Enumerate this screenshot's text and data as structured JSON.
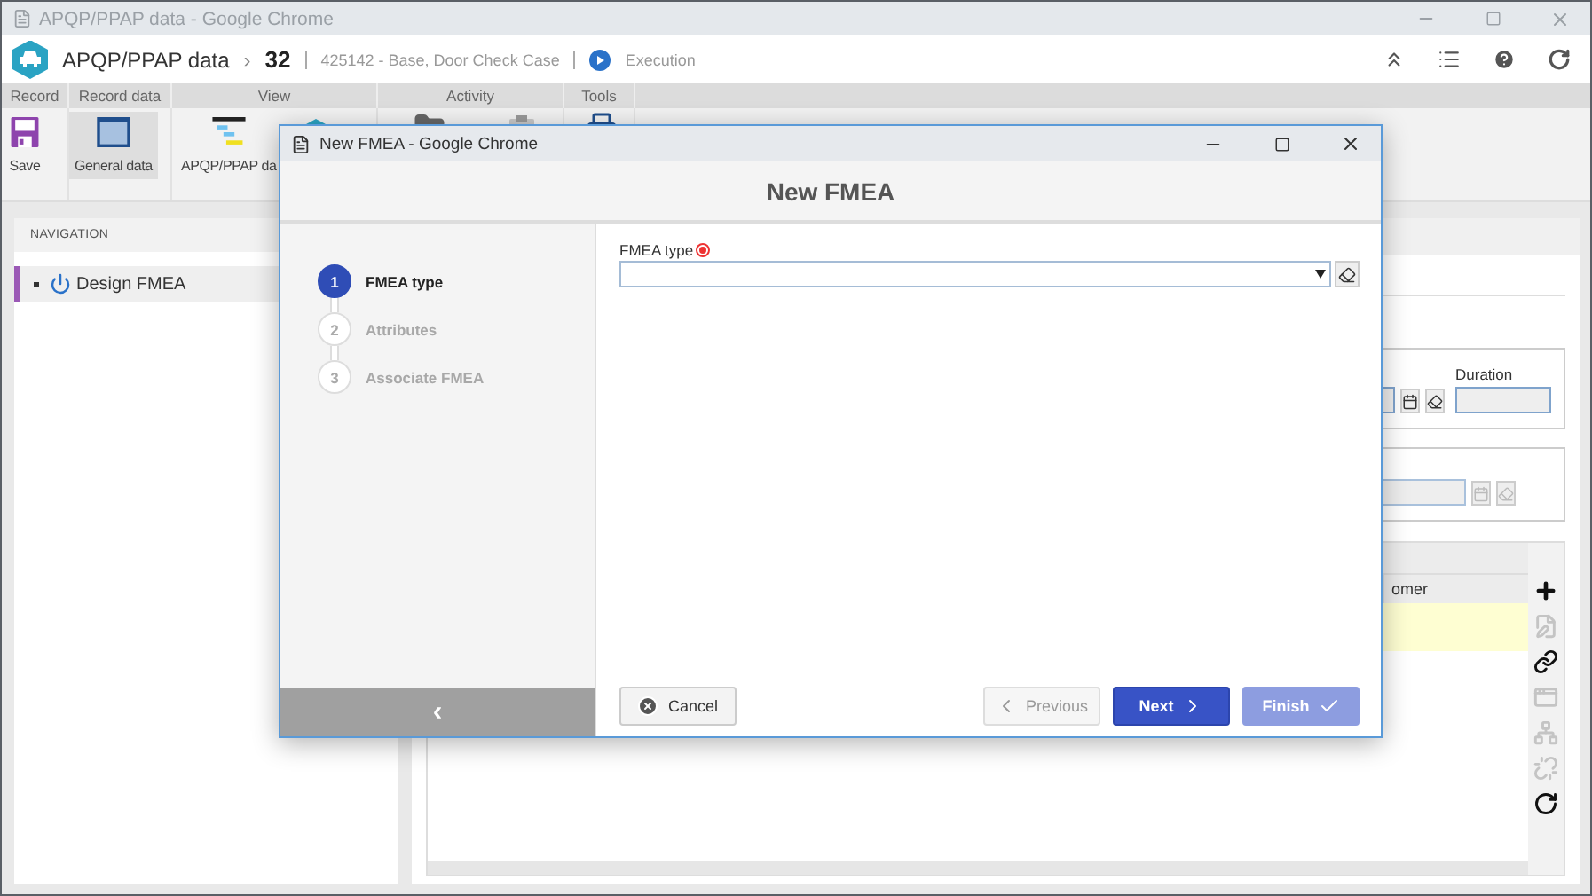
{
  "window": {
    "title": "APQP/PPAP data - Google Chrome"
  },
  "header": {
    "app_name": "APQP/PPAP data",
    "separator": "›",
    "record_number": "32",
    "record_title": "425142 - Base, Door Check Case",
    "status": "Execution"
  },
  "ribbon": {
    "groups": [
      {
        "label": "Record"
      },
      {
        "label": "Record data"
      },
      {
        "label": "View"
      },
      {
        "label": "Activity"
      },
      {
        "label": "Tools"
      }
    ],
    "buttons": [
      {
        "label": "Save",
        "kind": "save",
        "selected": false
      },
      {
        "label": "General data",
        "kind": "general",
        "selected": true
      },
      {
        "label": "APQP/PPAP da",
        "kind": "gantt",
        "selected": false
      }
    ]
  },
  "navigation": {
    "title": "NAVIGATION",
    "items": [
      {
        "label": "Design FMEA",
        "selected": true
      }
    ]
  },
  "form": {
    "duration_label": "Duration"
  },
  "grid": {
    "columns": [
      "omer"
    ],
    "rows": [
      {
        "selected": true
      }
    ]
  },
  "side_toolbar": [
    {
      "kind": "add",
      "disabled": false
    },
    {
      "kind": "edit",
      "disabled": true
    },
    {
      "kind": "link",
      "disabled": false
    },
    {
      "kind": "view",
      "disabled": true
    },
    {
      "kind": "tree",
      "disabled": true
    },
    {
      "kind": "unlink",
      "disabled": true
    },
    {
      "kind": "refresh",
      "disabled": false
    }
  ],
  "dialog": {
    "title": "New FMEA - Google Chrome",
    "heading": "New FMEA",
    "back": "‹",
    "steps": [
      {
        "number": "1",
        "label": "FMEA type",
        "selected": true
      },
      {
        "number": "2",
        "label": "Attributes",
        "selected": false
      },
      {
        "number": "3",
        "label": "Associate FMEA",
        "selected": false
      }
    ],
    "field": {
      "label": "FMEA type",
      "required": true
    },
    "buttons": [
      {
        "label": "Cancel",
        "kind": "cancel",
        "disabled": false
      },
      {
        "label": "Previous",
        "kind": "previous",
        "disabled": true
      },
      {
        "label": "Next",
        "kind": "next",
        "disabled": false
      },
      {
        "label": "Finish",
        "kind": "finish",
        "disabled": true
      }
    ]
  }
}
